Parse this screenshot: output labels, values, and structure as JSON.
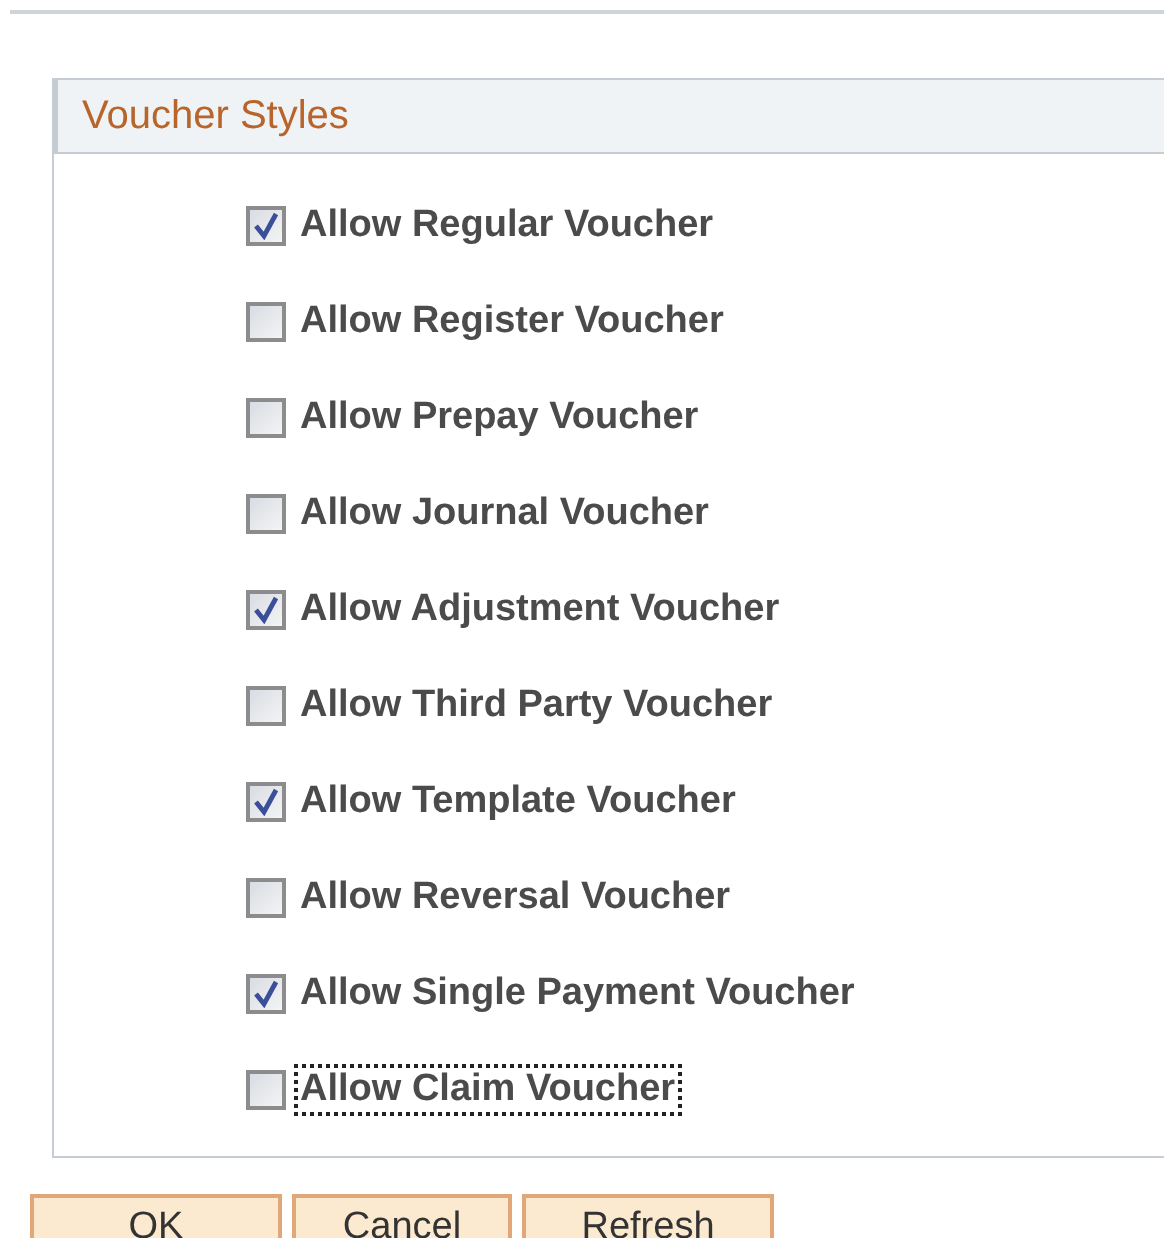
{
  "group": {
    "title": "Voucher Styles",
    "options": [
      {
        "label": "Allow Regular Voucher",
        "checked": true,
        "focused": false
      },
      {
        "label": "Allow Register Voucher",
        "checked": false,
        "focused": false
      },
      {
        "label": "Allow Prepay Voucher",
        "checked": false,
        "focused": false
      },
      {
        "label": "Allow Journal Voucher",
        "checked": false,
        "focused": false
      },
      {
        "label": "Allow Adjustment Voucher",
        "checked": true,
        "focused": false
      },
      {
        "label": "Allow Third Party Voucher",
        "checked": false,
        "focused": false
      },
      {
        "label": "Allow Template Voucher",
        "checked": true,
        "focused": false
      },
      {
        "label": "Allow Reversal Voucher",
        "checked": false,
        "focused": false
      },
      {
        "label": "Allow Single Payment Voucher",
        "checked": true,
        "focused": false
      },
      {
        "label": "Allow Claim Voucher",
        "checked": false,
        "focused": true
      }
    ]
  },
  "buttons": [
    "OK",
    "Cancel",
    "Refresh"
  ]
}
